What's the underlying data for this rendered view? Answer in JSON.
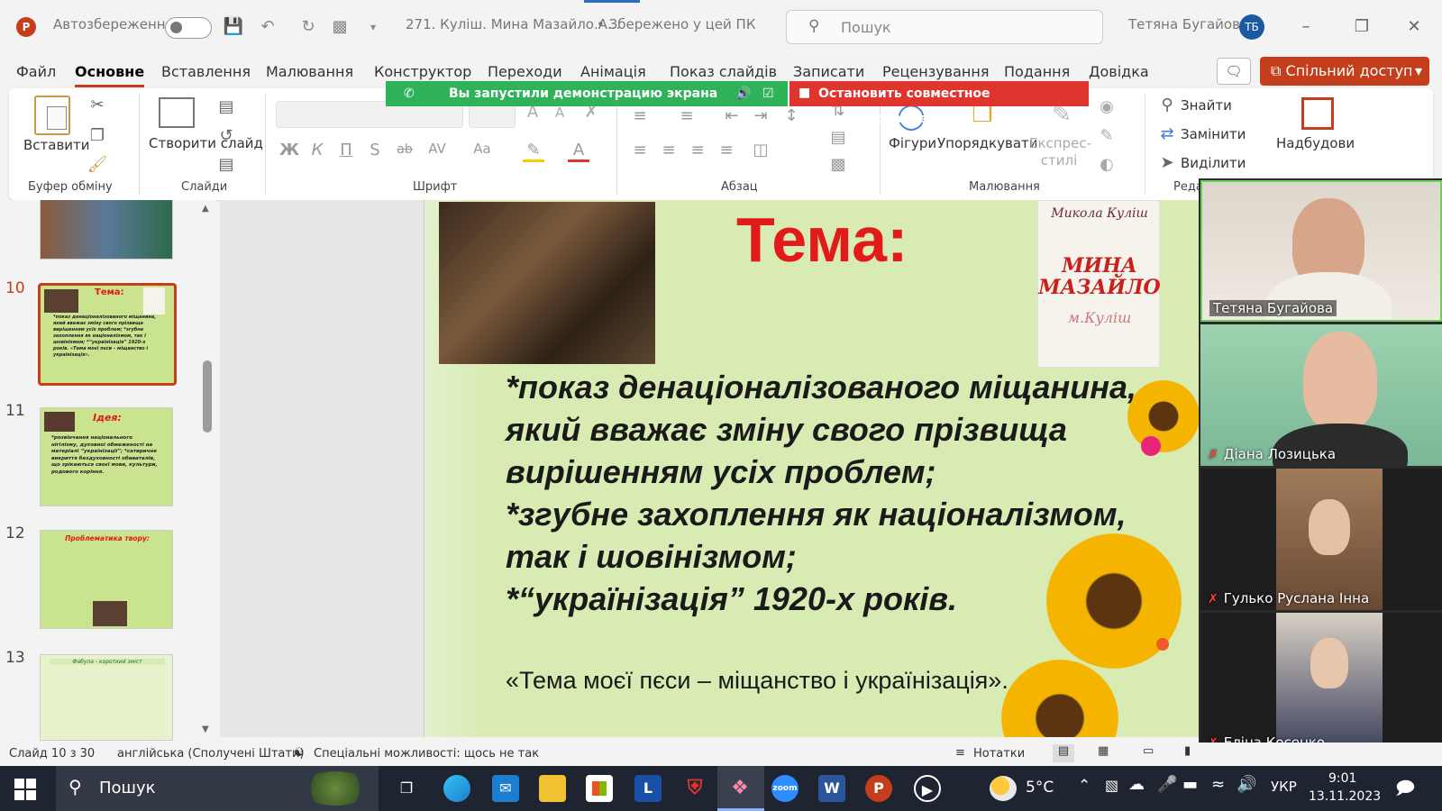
{
  "app": {
    "logo": "P",
    "autosave_label": "Автозбереження",
    "doc_title": "271. Куліш. Мина Мазайло.А...",
    "save_status": "• Збережено у цей ПК",
    "search_placeholder": "Пошук",
    "user_name": "Тетяна Бугайова",
    "user_initials": "ТБ"
  },
  "menu": {
    "tabs": [
      "Файл",
      "Основне",
      "Вставлення",
      "Малювання",
      "Конструктор",
      "Переходи",
      "Анімація",
      "Показ слайдів",
      "Записати",
      "Рецензування",
      "Подання",
      "Довідка"
    ],
    "active": "Основне",
    "share_label": "Спільний доступ"
  },
  "screen_share": {
    "status_text": "Вы запустили демонстрацию экрана",
    "stop_label": "Остановить совместное использование"
  },
  "ribbon": {
    "paste_label": "Вставити",
    "new_slide_label": "Створити слайд",
    "format_buttons": [
      "Ж",
      "К",
      "П",
      "S",
      "ab",
      "AV",
      "Aa"
    ],
    "shapes_label": "Фігури",
    "arrange_label": "Упорядкувати",
    "quick_styles_label": "Експрес-стилі",
    "find_label": "Знайти",
    "replace_label": "Замінити",
    "select_label": "Виділити",
    "addins_label": "Надбудови",
    "groups": [
      "Буфер обміну",
      "Слайди",
      "Шрифт",
      "Абзац",
      "Малювання",
      "Реда"
    ]
  },
  "thumbnails": {
    "numbers": [
      "10",
      "11",
      "12",
      "13"
    ],
    "t10_title": "Тема:",
    "t10_text": "*показ денаціоналізованого міщанина, який вважає зміну свого прізвища вирішенням усіх проблем; *згубне захоплення як націоналізмом, так і шовінізмом; *“українізація” 1920-х років. «Тема моєї пєси – міщанство і українізація».",
    "t11_title": "Ідея:",
    "t11_text": "*розвінчання національного нігілізму, духовної обмеженості на матеріалі “українізації”; *сатиричне викриття бездуховності обивателів, що зрікаються своєї мови, культури, родового коріння.",
    "t12_title": "Проблематика твору:",
    "t13_title": "Фабула - короткий зміст"
  },
  "slide": {
    "title": "Тема:",
    "body": "*показ денаціоналізованого міщанина, який вважає зміну свого прізвища вирішенням усіх проблем;\n*згубне захоплення як націоналізмом, так і шовінізмом;\n*“українізація” 1920-х років.",
    "quote": "«Тема моєї пєси – міщанство і українізація».",
    "book_author": "Микола Куліш",
    "book_title": "МИНА МАЗАЙЛО",
    "book_signature": "м.Куліш"
  },
  "participants": [
    {
      "name": "Тетяна Бугайова",
      "muted": false
    },
    {
      "name": "Діана Лозицька",
      "muted": true
    },
    {
      "name": "Гулько Руслана Інна",
      "muted": true
    },
    {
      "name": "Еліна Косенко",
      "muted": true
    }
  ],
  "statusbar": {
    "slide_info": "Слайд 10 з 30",
    "language": "англійська (Сполучені Штати)",
    "accessibility": "Спеціальні можливості: щось не так",
    "notes_label": "Нотатки"
  },
  "taskbar": {
    "search_label": "Пошук",
    "weather": "5°C",
    "lang": "УКР",
    "time": "9:01",
    "date": "13.11.2023"
  },
  "colors": {
    "accent": "#c43e1c",
    "share_green": "#2fb35a",
    "stop_red": "#e0352f",
    "slide_title_red": "#e21a1a",
    "slide_bg": "#d7ebb2"
  }
}
